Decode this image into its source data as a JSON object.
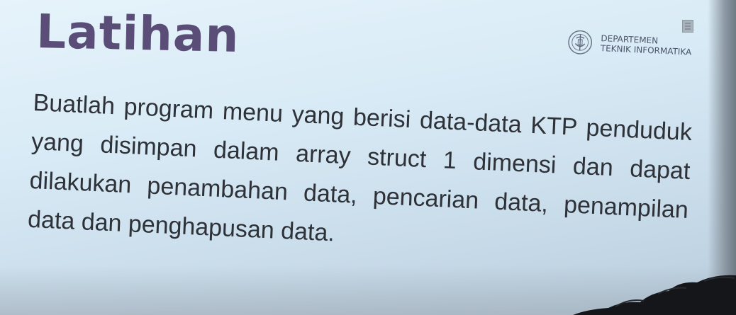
{
  "slide": {
    "title": "Latihan",
    "logo": {
      "icon": "its-emblem-icon",
      "line1": "DEPARTEMEN",
      "line2": "TEKNIK INFORMATIKA"
    },
    "body": "Buatlah program menu yang berisi data-data KTP penduduk yang disimpan dalam array struct 1 dimensi dan dapat dilakukan penambahan data, pencarian data, penampilan data dan penghapusan data."
  },
  "colors": {
    "title": "#5a4e78",
    "body_text": "#2e3238",
    "screen": "#dcebf5"
  }
}
